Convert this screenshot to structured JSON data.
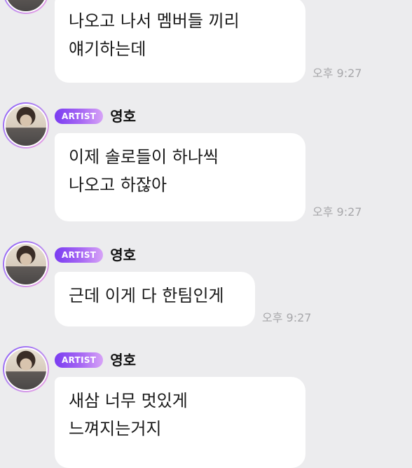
{
  "messages": [
    {
      "lines": [
        "나오고 나서 멤버들 끼리",
        "얘기하는데"
      ],
      "time": "오후 9:27"
    },
    {
      "badge": "ARTIST",
      "sender": "영호",
      "lines": [
        "이제 솔로들이 하나씩",
        "나오고 하잖아"
      ],
      "time": "오후 9:27"
    },
    {
      "badge": "ARTIST",
      "sender": "영호",
      "lines": [
        "근데 이게 다 한팀인게"
      ],
      "time": "오후 9:27"
    },
    {
      "badge": "ARTIST",
      "sender": "영호",
      "lines": [
        "새삼 너무 멋있게",
        "느껴지는거지"
      ]
    }
  ]
}
